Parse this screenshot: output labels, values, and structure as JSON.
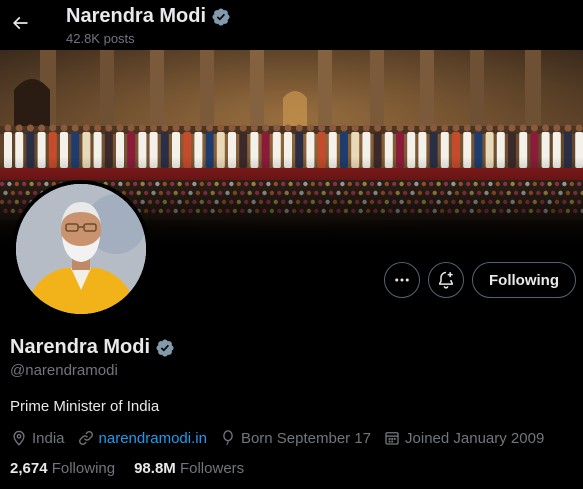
{
  "header": {
    "name": "Narendra Modi",
    "posts_count": "42.8K posts",
    "back_icon": "arrow-left-icon",
    "verified_icon": "verified-badge-icon"
  },
  "banner": {
    "description_icon": "banner-photo"
  },
  "actions": {
    "more_icon": "more-horizontal-icon",
    "notify_icon": "notification-bell-plus-icon",
    "following_label": "Following"
  },
  "profile": {
    "name": "Narendra Modi",
    "handle": "@narendramodi",
    "bio": "Prime Minister of India",
    "location": "India",
    "website": "narendramodi.in",
    "birthday": "Born September 17",
    "joined": "Joined January 2009"
  },
  "stats": {
    "following_count": "2,674",
    "following_label": "Following",
    "followers_count": "98.8M",
    "followers_label": "Followers"
  },
  "colors": {
    "background": "#000000",
    "text_primary": "#e7e9ea",
    "text_secondary": "#71767b",
    "link": "#1d9bf0",
    "verified_badge": "#829aab",
    "avatar_vest": "#f2b21a"
  }
}
